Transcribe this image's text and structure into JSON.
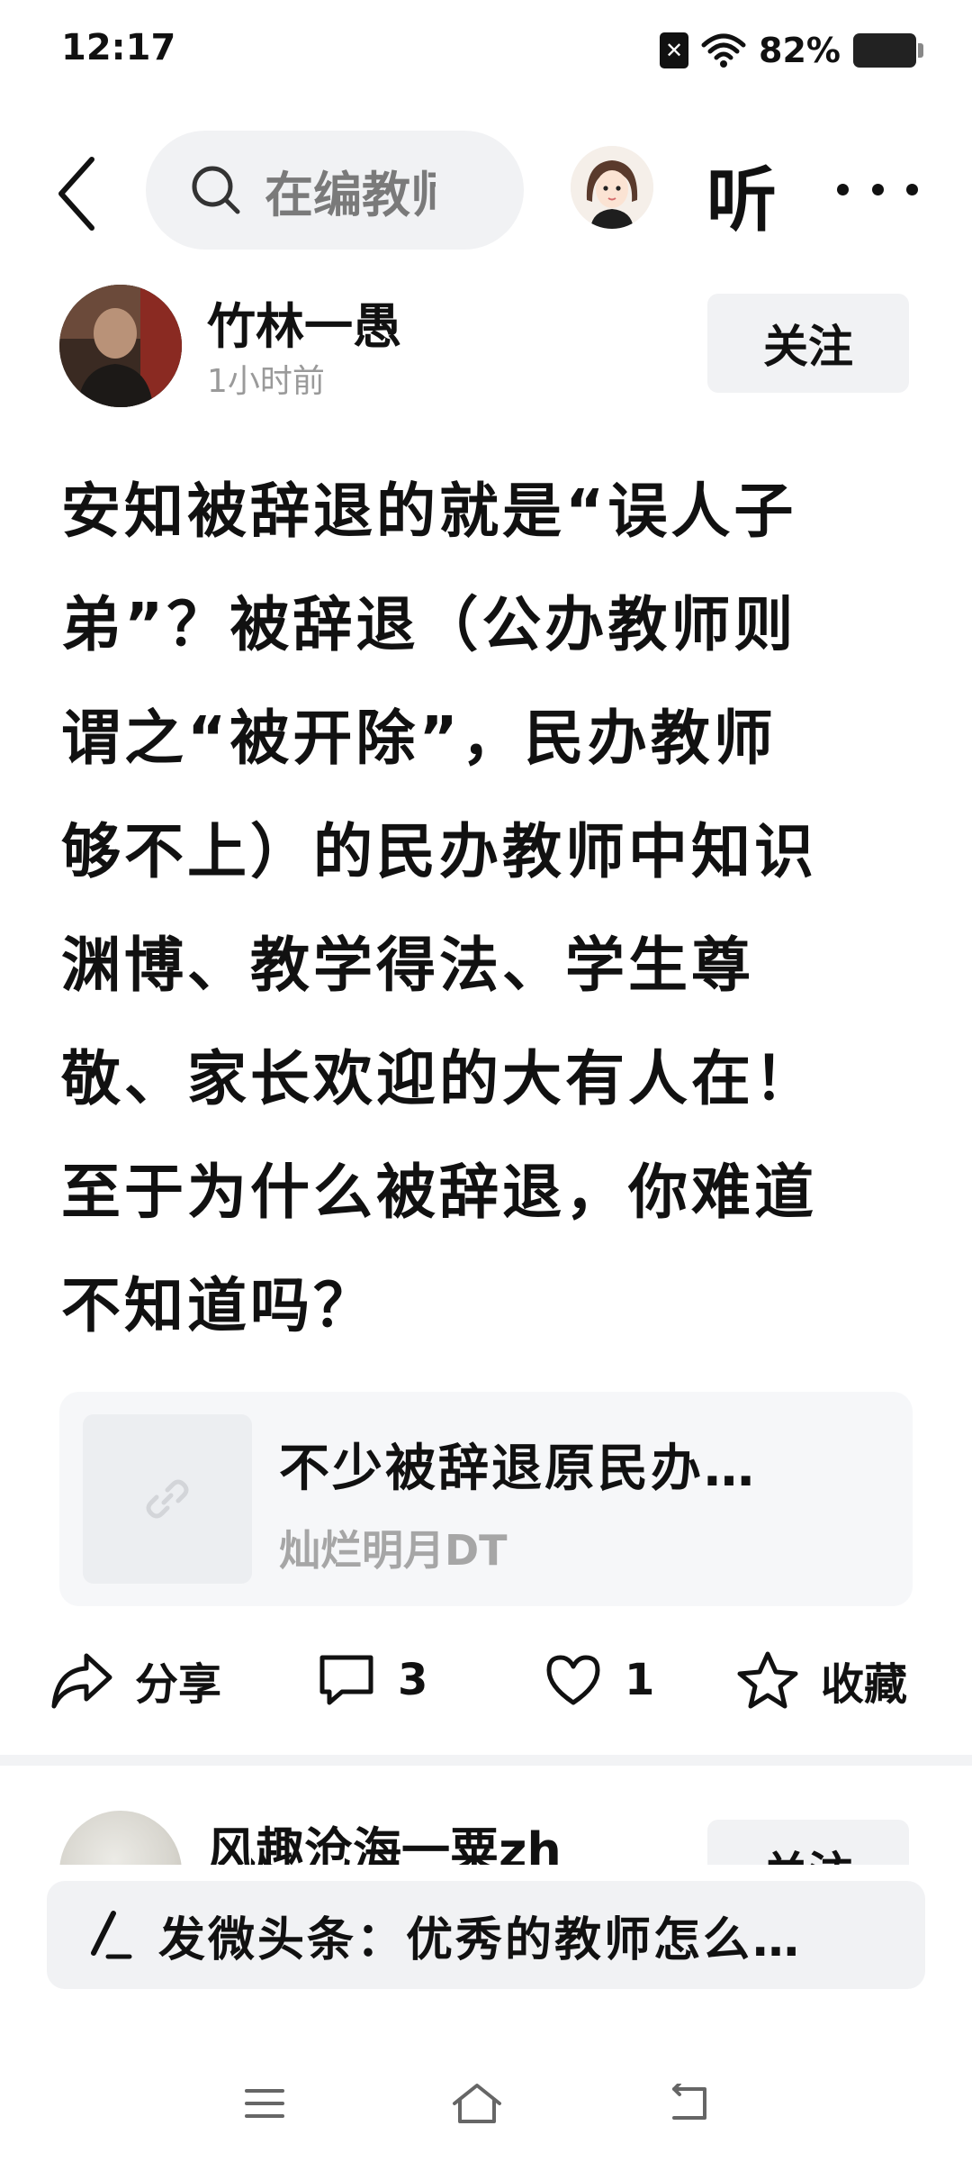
{
  "status_bar": {
    "time": "12:17",
    "sim_icon": "sim-off-icon",
    "wifi_icon": "wifi-icon",
    "battery_percent": "82%",
    "battery_icon": "battery-icon",
    "battery_level": 0.82
  },
  "top_nav": {
    "back_icon": "back-arrow-icon",
    "search_icon": "search-icon",
    "search_text": "在编教师",
    "avatar_icon": "cartoon-avatar-icon",
    "listen_label": "听",
    "more_icon": "more-dots-icon"
  },
  "author": {
    "name": "竹林一愚",
    "time": "1小时前",
    "follow_label": "关注"
  },
  "post": {
    "lines": [
      "安知被辞退的就是“误人子",
      "弟”？被辞退（公办教师则",
      "谓之“被开除”，民办教师",
      "够不上）的民办教师中知识",
      "渊博、教学得法、学生尊",
      "敬、家长欢迎的大有人在！",
      "至于为什么被辞退，你难道",
      "不知道吗？"
    ]
  },
  "link_card": {
    "icon": "link-icon",
    "title": "不少被辞退原民办…",
    "source": "灿烂明月DT"
  },
  "actions": {
    "share_icon": "share-icon",
    "share_label": "分享",
    "comment_icon": "comment-icon",
    "comment_count": "3",
    "like_icon": "heart-icon",
    "like_count": "1",
    "favorite_icon": "star-icon",
    "favorite_label": "收藏"
  },
  "next_post": {
    "name": "风趣沧海一粟zh",
    "follow_label": "关注"
  },
  "compose": {
    "icon": "pen-icon",
    "text": "发微头条：优秀的教师怎么…"
  },
  "nav_bar": {
    "menu_icon": "menu-icon",
    "home_icon": "home-icon",
    "back_icon": "system-back-icon"
  }
}
